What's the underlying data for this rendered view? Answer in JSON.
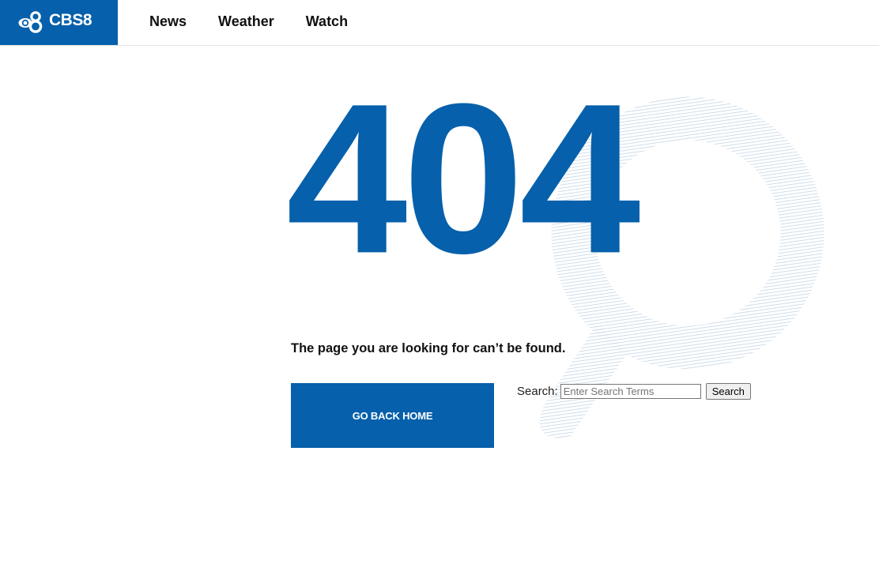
{
  "brand": {
    "name": "CBS8",
    "color": "#0660ab"
  },
  "nav": {
    "items": [
      {
        "label": "News"
      },
      {
        "label": "Weather"
      },
      {
        "label": "Watch"
      }
    ]
  },
  "error": {
    "code": "404",
    "message": "The page you are looking for can’t be found."
  },
  "actions": {
    "home_label": "GO BACK HOME"
  },
  "search": {
    "label": "Search:",
    "placeholder": "Enter Search Terms",
    "value": "",
    "submit_label": "Search"
  },
  "icons": {
    "logo": "cbs-eye-8-logo",
    "background": "magnifying-glass-icon"
  }
}
